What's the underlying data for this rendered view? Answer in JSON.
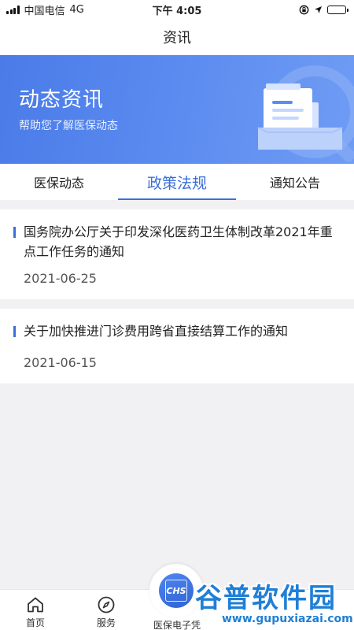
{
  "status_bar": {
    "carrier": "中国电信",
    "network": "4G",
    "time": "下午 4:05"
  },
  "nav": {
    "title": "资讯"
  },
  "banner": {
    "title": "动态资讯",
    "subtitle": "帮助您了解医保动态",
    "illustration": "document-tray-magnifier-icon"
  },
  "tabs": [
    {
      "label": "医保动态",
      "active": false
    },
    {
      "label": "政策法规",
      "active": true
    },
    {
      "label": "通知公告",
      "active": false
    }
  ],
  "articles": [
    {
      "title": "国务院办公厅关于印发深化医药卫生体制改革2021年重点工作任务的通知",
      "date": "2021-06-25"
    },
    {
      "title": "关于加快推进门诊费用跨省直接结算工作的通知",
      "date": "2021-06-15"
    }
  ],
  "bottom_nav": {
    "home": {
      "label": "首页",
      "icon": "home-icon"
    },
    "service": {
      "label": "服务",
      "icon": "compass-icon"
    },
    "ecard": {
      "label": "医保电子凭",
      "badge": "CHS",
      "icon": "chs-scan-icon"
    }
  },
  "watermark": {
    "name": "谷普软件园",
    "url": "www.gupuxiazai.com"
  },
  "colors": {
    "accent": "#3b6fd8",
    "banner": "#5a8bef"
  }
}
